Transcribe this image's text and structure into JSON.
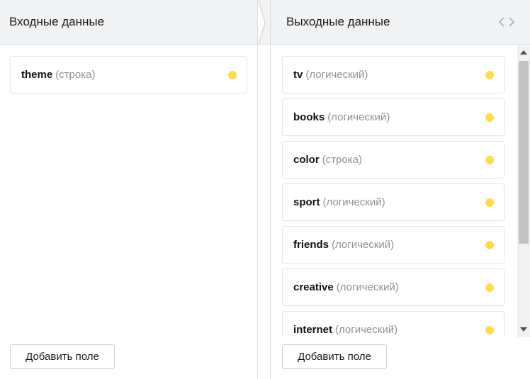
{
  "input_panel": {
    "title": "Входные данные",
    "fields": [
      {
        "name": "theme",
        "type": "(строка)"
      }
    ],
    "add_button": "Добавить поле"
  },
  "output_panel": {
    "title": "Выходные данные",
    "fields": [
      {
        "name": "tv",
        "type": "(логический)"
      },
      {
        "name": "books",
        "type": "(логический)"
      },
      {
        "name": "color",
        "type": "(строка)"
      },
      {
        "name": "sport",
        "type": "(логический)"
      },
      {
        "name": "friends",
        "type": "(логический)"
      },
      {
        "name": "creative",
        "type": "(логический)"
      },
      {
        "name": "internet",
        "type": "(логический)"
      }
    ],
    "add_button": "Добавить поле"
  },
  "icons": {
    "code_toggle": "code-brackets-icon",
    "status_dot": "status-dot-icon"
  },
  "colors": {
    "status_dot": "#ffdb4d",
    "header_bg": "#f1f2f3",
    "type_text": "#8e9196"
  }
}
